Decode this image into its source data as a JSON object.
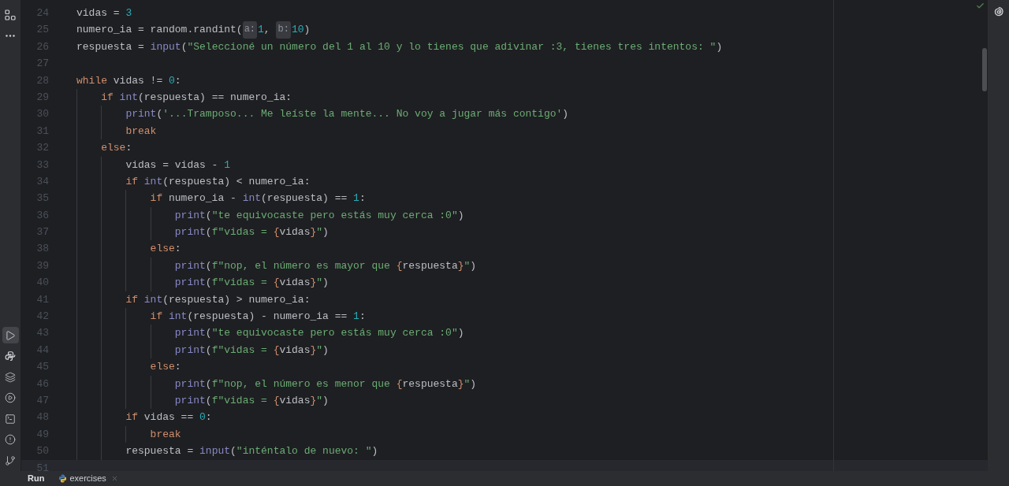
{
  "activity_bar": {
    "top": [
      {
        "selected": false
      },
      {
        "selected": false
      }
    ],
    "bottom": [
      {
        "selected": true
      },
      {
        "selected": false
      },
      {
        "selected": false
      },
      {
        "selected": false
      },
      {
        "selected": false
      },
      {
        "selected": false
      },
      {
        "selected": false
      }
    ]
  },
  "editor": {
    "lines": [
      {
        "number": "24",
        "current": false,
        "tokens": [
          {
            "kind": "plain",
            "text": "vidas = "
          },
          {
            "kind": "number",
            "text": "3"
          }
        ]
      },
      {
        "number": "25",
        "current": false,
        "tokens": [
          {
            "kind": "plain",
            "text": "numero_ia = random.randint("
          },
          {
            "kind": "hint",
            "text": "a:"
          },
          {
            "kind": "number",
            "text": "1"
          },
          {
            "kind": "plain",
            "text": ", "
          },
          {
            "kind": "hint",
            "text": "b:"
          },
          {
            "kind": "number",
            "text": "10"
          },
          {
            "kind": "plain",
            "text": ")"
          }
        ]
      },
      {
        "number": "26",
        "current": false,
        "tokens": [
          {
            "kind": "plain",
            "text": "respuesta = "
          },
          {
            "kind": "builtin",
            "text": "input"
          },
          {
            "kind": "plain",
            "text": "("
          },
          {
            "kind": "string",
            "text": "\"Seleccioné un número del 1 al 10 y lo tienes que adivinar :3, tienes tres intentos: \""
          },
          {
            "kind": "plain",
            "text": ")"
          }
        ]
      },
      {
        "number": "27",
        "current": false
      },
      {
        "number": "28",
        "current": false,
        "tokens": [
          {
            "kind": "keyword",
            "text": "while "
          },
          {
            "kind": "plain",
            "text": "vidas != "
          },
          {
            "kind": "number",
            "text": "0"
          },
          {
            "kind": "plain",
            "text": ":"
          }
        ]
      },
      {
        "number": "29",
        "current": false,
        "tokens": [
          {
            "kind": "keyword",
            "text": "    if "
          },
          {
            "kind": "builtin",
            "text": "int"
          },
          {
            "kind": "plain",
            "text": "(respuesta) == numero_ia:"
          }
        ]
      },
      {
        "number": "30",
        "current": false,
        "tokens": [
          {
            "kind": "builtin",
            "text": "        print"
          },
          {
            "kind": "plain",
            "text": "("
          },
          {
            "kind": "string",
            "text": "'...Tramposo... Me leíste la mente... No voy a jugar más contigo'"
          },
          {
            "kind": "plain",
            "text": ")"
          }
        ]
      },
      {
        "number": "31",
        "current": false,
        "tokens": [
          {
            "kind": "keyword",
            "text": "        break"
          }
        ]
      },
      {
        "number": "32",
        "current": false,
        "tokens": [
          {
            "kind": "keyword",
            "text": "    else"
          },
          {
            "kind": "plain",
            "text": ":"
          }
        ]
      },
      {
        "number": "33",
        "current": false,
        "tokens": [
          {
            "kind": "plain",
            "text": "        vidas = vidas - "
          },
          {
            "kind": "number",
            "text": "1"
          }
        ]
      },
      {
        "number": "34",
        "current": false,
        "tokens": [
          {
            "kind": "keyword",
            "text": "        if "
          },
          {
            "kind": "builtin",
            "text": "int"
          },
          {
            "kind": "plain",
            "text": "(respuesta) < numero_ia:"
          }
        ]
      },
      {
        "number": "35",
        "current": false,
        "tokens": [
          {
            "kind": "keyword",
            "text": "            if "
          },
          {
            "kind": "plain",
            "text": "numero_ia - "
          },
          {
            "kind": "builtin",
            "text": "int"
          },
          {
            "kind": "plain",
            "text": "(respuesta) == "
          },
          {
            "kind": "number",
            "text": "1"
          },
          {
            "kind": "plain",
            "text": ":"
          }
        ]
      },
      {
        "number": "36",
        "current": false,
        "tokens": [
          {
            "kind": "builtin",
            "text": "                print"
          },
          {
            "kind": "plain",
            "text": "("
          },
          {
            "kind": "string",
            "text": "\"te equivocaste pero estás muy cerca :0\""
          },
          {
            "kind": "plain",
            "text": ")"
          }
        ]
      },
      {
        "number": "37",
        "current": false,
        "tokens": [
          {
            "kind": "builtin",
            "text": "                print"
          },
          {
            "kind": "plain",
            "text": "("
          },
          {
            "kind": "string",
            "text": "f\"vidas = "
          },
          {
            "kind": "brace",
            "text": "{"
          },
          {
            "kind": "plain",
            "text": "vidas"
          },
          {
            "kind": "brace",
            "text": "}"
          },
          {
            "kind": "string",
            "text": "\""
          },
          {
            "kind": "plain",
            "text": ")"
          }
        ]
      },
      {
        "number": "38",
        "current": false,
        "tokens": [
          {
            "kind": "keyword",
            "text": "            else"
          },
          {
            "kind": "plain",
            "text": ":"
          }
        ]
      },
      {
        "number": "39",
        "current": false,
        "tokens": [
          {
            "kind": "builtin",
            "text": "                print"
          },
          {
            "kind": "plain",
            "text": "("
          },
          {
            "kind": "string",
            "text": "f\"nop, el número es mayor que "
          },
          {
            "kind": "brace",
            "text": "{"
          },
          {
            "kind": "plain",
            "text": "respuesta"
          },
          {
            "kind": "brace",
            "text": "}"
          },
          {
            "kind": "string",
            "text": "\""
          },
          {
            "kind": "plain",
            "text": ")"
          }
        ]
      },
      {
        "number": "40",
        "current": false,
        "tokens": [
          {
            "kind": "builtin",
            "text": "                print"
          },
          {
            "kind": "plain",
            "text": "("
          },
          {
            "kind": "string",
            "text": "f\"vidas = "
          },
          {
            "kind": "brace",
            "text": "{"
          },
          {
            "kind": "plain",
            "text": "vidas"
          },
          {
            "kind": "brace",
            "text": "}"
          },
          {
            "kind": "string",
            "text": "\""
          },
          {
            "kind": "plain",
            "text": ")"
          }
        ]
      },
      {
        "number": "41",
        "current": false,
        "tokens": [
          {
            "kind": "keyword",
            "text": "        if "
          },
          {
            "kind": "builtin",
            "text": "int"
          },
          {
            "kind": "plain",
            "text": "(respuesta) > numero_ia:"
          }
        ]
      },
      {
        "number": "42",
        "current": false,
        "tokens": [
          {
            "kind": "keyword",
            "text": "            if "
          },
          {
            "kind": "builtin",
            "text": "int"
          },
          {
            "kind": "plain",
            "text": "(respuesta) - numero_ia == "
          },
          {
            "kind": "number",
            "text": "1"
          },
          {
            "kind": "plain",
            "text": ":"
          }
        ]
      },
      {
        "number": "43",
        "current": false,
        "tokens": [
          {
            "kind": "builtin",
            "text": "                print"
          },
          {
            "kind": "plain",
            "text": "("
          },
          {
            "kind": "string",
            "text": "\"te equivocaste pero estás muy cerca :0\""
          },
          {
            "kind": "plain",
            "text": ")"
          }
        ]
      },
      {
        "number": "44",
        "current": false,
        "tokens": [
          {
            "kind": "builtin",
            "text": "                print"
          },
          {
            "kind": "plain",
            "text": "("
          },
          {
            "kind": "string",
            "text": "f\"vidas = "
          },
          {
            "kind": "brace",
            "text": "{"
          },
          {
            "kind": "plain",
            "text": "vidas"
          },
          {
            "kind": "brace",
            "text": "}"
          },
          {
            "kind": "string",
            "text": "\""
          },
          {
            "kind": "plain",
            "text": ")"
          }
        ]
      },
      {
        "number": "45",
        "current": false,
        "tokens": [
          {
            "kind": "keyword",
            "text": "            else"
          },
          {
            "kind": "plain",
            "text": ":"
          }
        ]
      },
      {
        "number": "46",
        "current": false,
        "tokens": [
          {
            "kind": "builtin",
            "text": "                print"
          },
          {
            "kind": "plain",
            "text": "("
          },
          {
            "kind": "string",
            "text": "f\"nop, el número es menor que "
          },
          {
            "kind": "brace",
            "text": "{"
          },
          {
            "kind": "plain",
            "text": "respuesta"
          },
          {
            "kind": "brace",
            "text": "}"
          },
          {
            "kind": "string",
            "text": "\""
          },
          {
            "kind": "plain",
            "text": ")"
          }
        ]
      },
      {
        "number": "47",
        "current": false,
        "tokens": [
          {
            "kind": "builtin",
            "text": "                print"
          },
          {
            "kind": "plain",
            "text": "("
          },
          {
            "kind": "string",
            "text": "f\"vidas = "
          },
          {
            "kind": "brace",
            "text": "{"
          },
          {
            "kind": "plain",
            "text": "vidas"
          },
          {
            "kind": "brace",
            "text": "}"
          },
          {
            "kind": "string",
            "text": "\""
          },
          {
            "kind": "plain",
            "text": ")"
          }
        ]
      },
      {
        "number": "48",
        "current": false,
        "tokens": [
          {
            "kind": "keyword",
            "text": "        if "
          },
          {
            "kind": "plain",
            "text": "vidas == "
          },
          {
            "kind": "number",
            "text": "0"
          },
          {
            "kind": "plain",
            "text": ":"
          }
        ]
      },
      {
        "number": "49",
        "current": false,
        "tokens": [
          {
            "kind": "keyword",
            "text": "            break"
          }
        ]
      },
      {
        "number": "50",
        "current": false,
        "tokens": [
          {
            "kind": "plain",
            "text": "        respuesta = "
          },
          {
            "kind": "builtin",
            "text": "input"
          },
          {
            "kind": "plain",
            "text": "("
          },
          {
            "kind": "string",
            "text": "\"inténtalo de nuevo: \""
          },
          {
            "kind": "plain",
            "text": ")"
          }
        ]
      },
      {
        "number": "51",
        "current": true
      }
    ]
  },
  "bottom_panel": {
    "title": "Run",
    "tabs": [
      {
        "label": "exercises"
      }
    ]
  }
}
